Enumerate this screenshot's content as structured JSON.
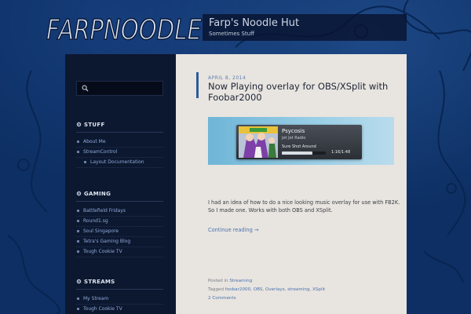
{
  "logo_text": "FARPNOODLE",
  "site": {
    "title": "Farp's Noodle Hut",
    "description": "Sometimes Stuff"
  },
  "search": {
    "placeholder": "",
    "icon": "search-icon"
  },
  "widgets": [
    {
      "title": "STUFF",
      "icon": "gear-icon",
      "items": [
        {
          "label": "About Me"
        },
        {
          "label": "StreamControl"
        },
        {
          "label": "Layout Documentation",
          "child": true
        }
      ]
    },
    {
      "title": "GAMING",
      "icon": "gear-icon",
      "items": [
        {
          "label": "Battlefield Fridays"
        },
        {
          "label": "Round1.sg"
        },
        {
          "label": "Soul Singapore"
        },
        {
          "label": "Tetra's Gaming Blog"
        },
        {
          "label": "Tough Cookie TV"
        }
      ]
    },
    {
      "title": "STREAMS",
      "icon": "gear-icon",
      "items": [
        {
          "label": "My Stream"
        },
        {
          "label": "Tough Cookie TV"
        }
      ]
    }
  ],
  "post": {
    "date": "APRIL 8, 2014",
    "title": "Now Playing overlay for OBS/XSplit with Foobar2000",
    "image": {
      "track_title": "Psycosis",
      "track_artist": "Jet Jet Radio",
      "track_album": "Sure Shot Around",
      "time": "1:16/1:48",
      "progress": 0.7
    },
    "body": "I had an idea of how to do a nice looking music overlay for use with FB2K. So I made one. Works with both OBS and XSplit.",
    "continue_label": "Continue reading →",
    "posted_in_prefix": "Posted in",
    "category": "Streaming",
    "tagged_prefix": "Tagged",
    "tags": [
      "foobar2000",
      "OBS",
      "Overlays",
      "streaming",
      "XSplit"
    ],
    "comments": "2 Comments"
  },
  "colors": {
    "background": "#0d2f63",
    "sidebar": "#0c1830",
    "content": "#e8e4df",
    "link": "#4a73b0",
    "accent": "#2e5b9a"
  }
}
